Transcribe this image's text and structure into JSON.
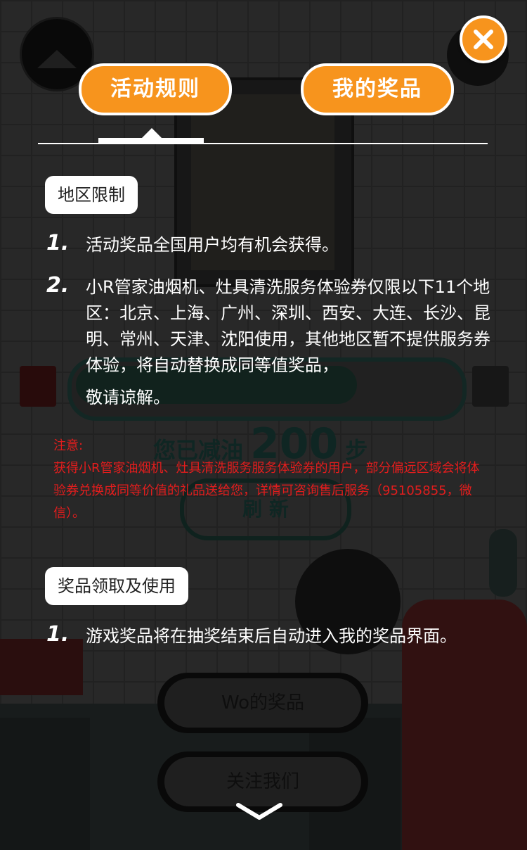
{
  "background": {
    "steps_prefix": "您已减油",
    "steps_value": "200",
    "steps_suffix": "步",
    "refresh_label": "刷  新",
    "wo_prizes_label": "Wo的奖品",
    "follow_label": "关注我们"
  },
  "tabs": {
    "rules_label": "活动规则",
    "prizes_label": "我的奖品",
    "active": "rules"
  },
  "sections": {
    "region": {
      "title": "地区限制",
      "items": [
        {
          "num": "1.",
          "text": "活动奖品全国用户均有机会获得。"
        },
        {
          "num": "2.",
          "text": "小R管家油烟机、灶具清洗服务体验券仅限以下11个地区：北京、上海、广州、深圳、西安、大连、长沙、昆明、常州、天津、沈阳使用，其他地区暂不提供服务券体验，将自动替换成同等值奖品，",
          "text2": "敬请谅解。"
        }
      ]
    },
    "note": {
      "label": "注意:",
      "text": "获得小R管家油烟机、灶具清洗服务服务体验券的用户，部分偏远区域会将体验券兑换成同等价值的礼品送给您，详情可咨询售后服务（95105855，微信）。"
    },
    "claim": {
      "title": "奖品领取及使用",
      "items": [
        {
          "num": "1.",
          "text": "游戏奖品将在抽奖结束后自动进入我的奖品界面。"
        }
      ]
    }
  },
  "colors": {
    "accent": "#f7941d",
    "note": "#e21d1d"
  },
  "icons": {
    "close": "close-icon",
    "scroll": "chevron-down-icon"
  }
}
